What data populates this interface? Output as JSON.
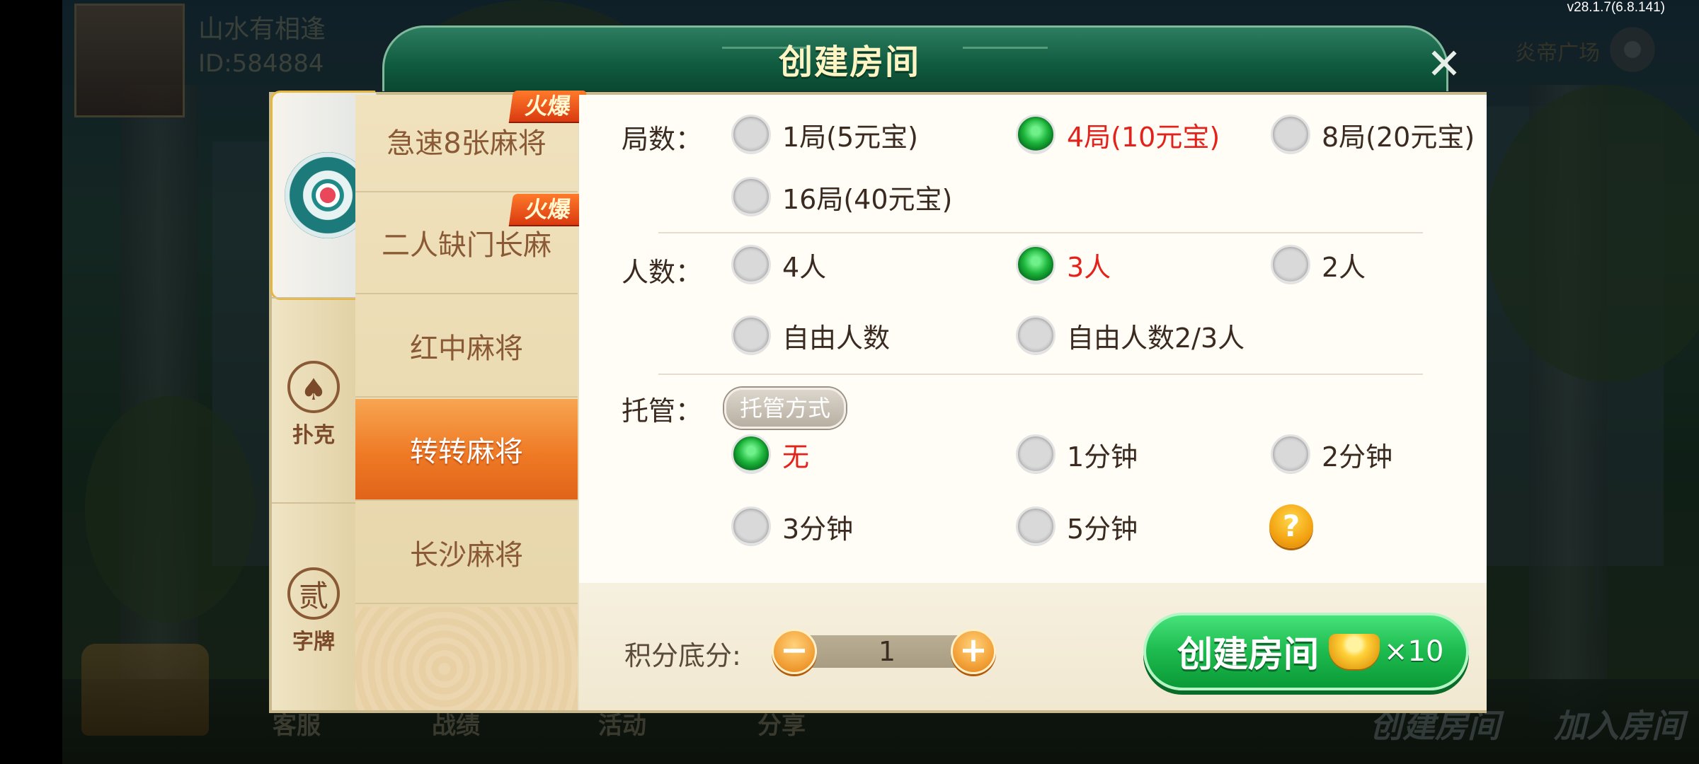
{
  "version": "v28.1.7(6.8.141)",
  "background": {
    "profile_name": "山水有相逢",
    "profile_id": "ID:584884",
    "plaza_label": "炎帝广场",
    "bottom_items": [
      "客服",
      "战绩",
      "活动",
      "分享"
    ],
    "bottom_create": "创建房间",
    "bottom_join": "加入房间"
  },
  "dialog": {
    "title": "创建房间",
    "close_symbol": "✕"
  },
  "categories": [
    {
      "label": "",
      "icon": "mahjong-emblem-icon"
    },
    {
      "label": "扑克",
      "glyph": "♠",
      "icon": "spade-icon"
    },
    {
      "label": "字牌",
      "glyph": "贰",
      "icon": "zipai-icon"
    }
  ],
  "games": [
    {
      "label": "急速8张麻将",
      "badge": "火爆"
    },
    {
      "label": "二人缺门长麻",
      "badge": "火爆"
    },
    {
      "label": "红中麻将"
    },
    {
      "label": "转转麻将",
      "selected": true
    },
    {
      "label": "长沙麻将"
    }
  ],
  "options": {
    "rounds": {
      "label": "局数：",
      "choices": [
        "1局(5元宝)",
        "4局(10元宝)",
        "8局(20元宝)",
        "16局(40元宝)"
      ],
      "selected": "4局(10元宝)"
    },
    "players": {
      "label": "人数：",
      "choices": [
        "4人",
        "3人",
        "2人",
        "自由人数",
        "自由人数2/3人"
      ],
      "selected": "3人"
    },
    "trustee": {
      "label": "托管：",
      "tag": "托管方式",
      "choices": [
        "无",
        "1分钟",
        "2分钟",
        "3分钟",
        "5分钟"
      ],
      "selected": "无",
      "help_symbol": "?"
    }
  },
  "footer": {
    "score_label": "积分底分:",
    "score_value": "1",
    "minus": "−",
    "plus": "+",
    "create_label": "创建房间",
    "cost": "×10"
  },
  "colors": {
    "accent_selected": "#e2221b",
    "header_green": "#0f5a3f",
    "create_green": "#1dba4f",
    "selected_tab_orange": "#ef7a25"
  }
}
